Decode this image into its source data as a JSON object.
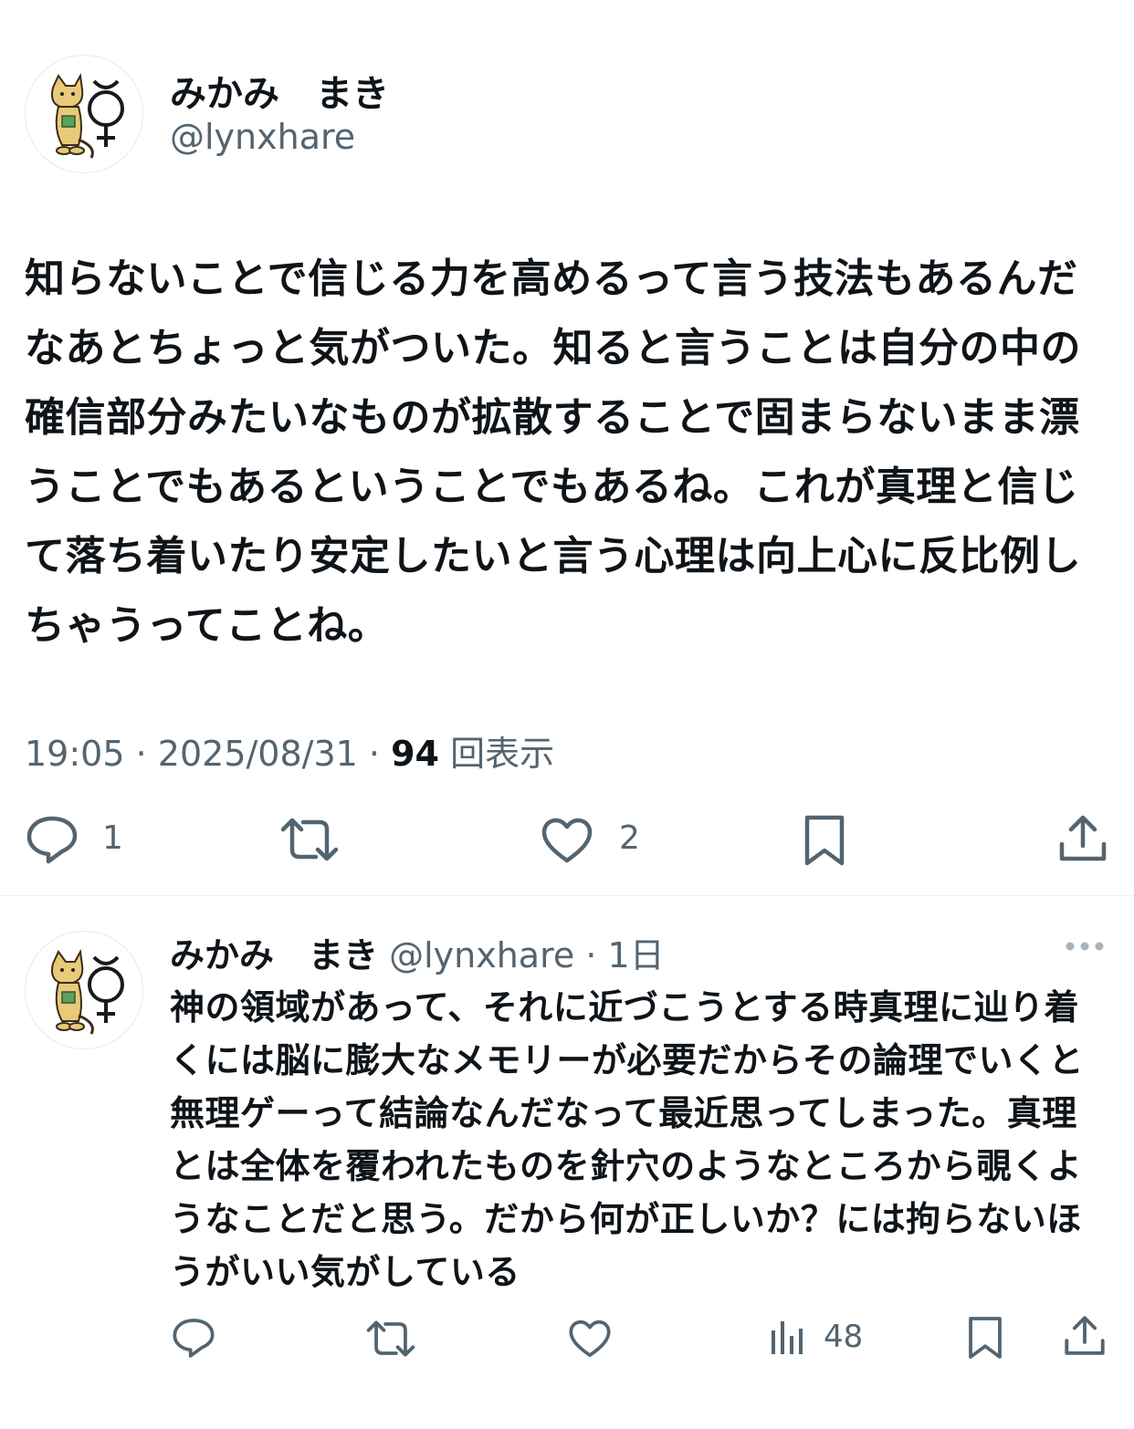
{
  "main_tweet": {
    "display_name": "みかみ　まき",
    "handle": "@lynxhare",
    "text": "知らないことで信じる力を高めるって言う技法もあるんだなあとちょっと気がついた。知ると言うことは自分の中の確信部分みたいなものが拡散することで固まらないまま漂うことでもあるということでもあるね。これが真理と信じて落ち着いたり安定したいと言う心理は向上心に反比例しちゃうってことね。",
    "time": "19:05",
    "sep": "·",
    "date": "2025/08/31",
    "views_count": "94",
    "views_label": "回表示",
    "actions": {
      "reply_icon": "reply-icon",
      "reply_count": "1",
      "retweet_icon": "retweet-icon",
      "like_icon": "heart-icon",
      "like_count": "2",
      "bookmark_icon": "bookmark-icon",
      "share_icon": "share-icon"
    }
  },
  "reply_tweet": {
    "display_name": "みかみ　まき",
    "handle": "@lynxhare",
    "sep": "·",
    "age": "1日",
    "more_icon": "more-icon",
    "text": "神の領域があって、それに近づこうとする時真理に辿り着くには脳に膨大なメモリーが必要だからその論理でいくと無理ゲーって結論なんだなって最近思ってしまった。真理とは全体を覆われたものを針穴のようなところから覗くようなことだと思う。だから何が正しいか？には拘らないほうがいい気がしている",
    "actions": {
      "reply_icon": "reply-icon",
      "retweet_icon": "retweet-icon",
      "like_icon": "heart-icon",
      "views_icon": "analytics-icon",
      "views_count": "48",
      "bookmark_icon": "bookmark-icon",
      "share_icon": "share-icon"
    }
  },
  "colors": {
    "text_primary": "#0f1419",
    "text_secondary": "#536471",
    "divider": "#eff3f4",
    "avatar_cat": "#e9c97a"
  }
}
